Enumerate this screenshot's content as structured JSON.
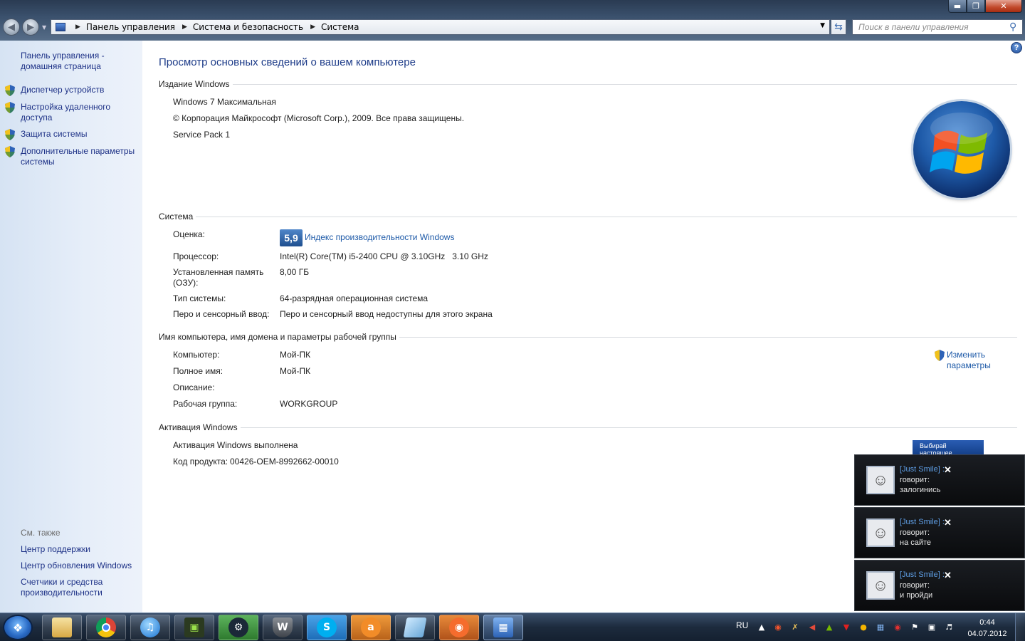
{
  "addressbar": {
    "crumbs": [
      "Панель управления",
      "Система и безопасность",
      "Система"
    ],
    "search_placeholder": "Поиск в панели управления"
  },
  "sidebar": {
    "home": "Панель управления - домашняя страница",
    "links": [
      "Диспетчер устройств",
      "Настройка удаленного доступа",
      "Защита системы",
      "Дополнительные параметры системы"
    ],
    "see_also_title": "См. также",
    "see_also": [
      "Центр поддержки",
      "Центр обновления Windows",
      "Счетчики и средства производительности"
    ]
  },
  "main": {
    "title": "Просмотр основных сведений о вашем компьютере",
    "edition": {
      "heading": "Издание Windows",
      "name": "Windows 7 Максимальная",
      "copyright": "© Корпорация Майкрософт (Microsoft Corp.), 2009. Все права защищены.",
      "service_pack": "Service Pack 1"
    },
    "system": {
      "heading": "Система",
      "rating_label": "Оценка:",
      "rating_value": "5,9",
      "rating_link": "Индекс производительности Windows",
      "cpu_label": "Процессор:",
      "cpu_value": "Intel(R) Core(TM) i5-2400 CPU @ 3.10GHz   3.10 GHz",
      "ram_label": "Установленная память (ОЗУ):",
      "ram_value": "8,00 ГБ",
      "type_label": "Тип системы:",
      "type_value": "64-разрядная операционная система",
      "pen_label": "Перо и сенсорный ввод:",
      "pen_value": "Перо и сенсорный ввод недоступны для этого экрана"
    },
    "computer": {
      "heading": "Имя компьютера, имя домена и параметры рабочей группы",
      "name_label": "Компьютер:",
      "name_value": "Мой-ПК",
      "full_label": "Полное имя:",
      "full_value": "Мой-ПК",
      "desc_label": "Описание:",
      "group_label": "Рабочая группа:",
      "group_value": "WORKGROUP",
      "change_link": "Изменить параметры"
    },
    "activation": {
      "heading": "Активация Windows",
      "status": "Активация Windows выполнена",
      "key_label": "Код продукта:",
      "key_value": "00426-OEM-8992662-00010",
      "ad_text": "Выбирай настоящее"
    }
  },
  "notifications": [
    {
      "name": "[Just Smile] :",
      "says": "говорит:",
      "message": "залогинись"
    },
    {
      "name": "[Just Smile] :",
      "says": "говорит:",
      "message": "на сайте"
    },
    {
      "name": "[Just Smile] :",
      "says": "говорит:",
      "message": "и пройди"
    }
  ],
  "taskbar": {
    "apps": [
      "explorer-icon",
      "chrome-icon",
      "itunes-icon",
      "game-icon",
      "steam-icon",
      "world-of-tanks-icon",
      "skype-icon",
      "avast-icon",
      "notepad-icon",
      "origin-icon",
      "control-panel-icon"
    ],
    "lang": "RU",
    "time": "0:44",
    "date": "04.07.2012"
  },
  "colors": {
    "link": "#1e5aa8",
    "title": "#1e3c89",
    "sidebar_bg": "#dbe6f4",
    "notification_name": "#5f9fe6"
  }
}
